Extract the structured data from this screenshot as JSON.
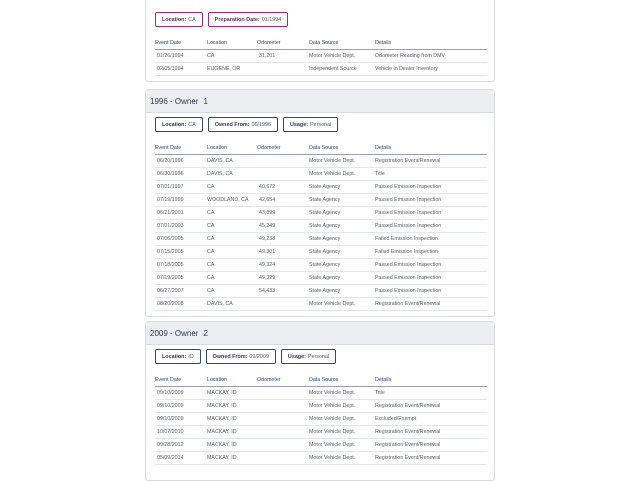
{
  "columns": [
    "Event Date",
    "Location",
    "Odometer",
    "Data Source",
    "Details"
  ],
  "sections": [
    {
      "header": null,
      "badges": [
        {
          "label": "Location:",
          "value": "CA"
        },
        {
          "label": "Preparation Date:",
          "value": "01/1994"
        }
      ],
      "rows": [
        [
          "01/26/1994",
          "CA",
          "31,201",
          "Motor Vehicle Dept.",
          "Odometer Reading from DMV"
        ],
        [
          "02/05/1994",
          "EUGENE, OR",
          "",
          "Independent Source",
          "Vehicle in Dealer Inventory"
        ]
      ]
    },
    {
      "header": {
        "year": "1996 - Owner",
        "num": "1"
      },
      "badges": [
        {
          "label": "Location:",
          "value": "CA"
        },
        {
          "label": "Owned From:",
          "value": "06/1996"
        },
        {
          "label": "Usage:",
          "value": "Personal"
        }
      ],
      "rows": [
        [
          "06/20/1996",
          "DAVIS, CA",
          "",
          "Motor Vehicle Dept.",
          "Registration Event/Renewal"
        ],
        [
          "06/30/1996",
          "DAVIS, CA",
          "",
          "Motor Vehicle Dept.",
          "Title"
        ],
        [
          "07/01/1997",
          "CA",
          "40,672",
          "State Agency",
          "Passed Emission Inspection"
        ],
        [
          "07/19/1999",
          "WOODLAND, CA",
          "42,654",
          "State Agency",
          "Passed Emission Inspection"
        ],
        [
          "06/21/2001",
          "CA",
          "43,899",
          "State Agency",
          "Passed Emission Inspection"
        ],
        [
          "07/01/2003",
          "CA",
          "45,249",
          "State Agency",
          "Passed Emission Inspection"
        ],
        [
          "07/06/2005",
          "CA",
          "49,238",
          "State Agency",
          "Failed Emission Inspection"
        ],
        [
          "07/15/2005",
          "CA",
          "49,301",
          "State Agency",
          "Failed Emission Inspection"
        ],
        [
          "07/18/2005",
          "CA",
          "49,324",
          "State Agency",
          "Passed Emission Inspection"
        ],
        [
          "07/19/2005",
          "CA",
          "49,329",
          "State Agency",
          "Passed Emission Inspection"
        ],
        [
          "06/27/2007",
          "CA",
          "54,433",
          "State Agency",
          "Passed Emission Inspection"
        ],
        [
          "08/20/2008",
          "DAVIS, CA",
          "",
          "Motor Vehicle Dept.",
          "Registration Event/Renewal"
        ]
      ]
    },
    {
      "header": {
        "year": "2009 - Owner",
        "num": "2"
      },
      "badges": [
        {
          "label": "Location:",
          "value": "ID"
        },
        {
          "label": "Owned From:",
          "value": "09/2009"
        },
        {
          "label": "Usage:",
          "value": "Personal"
        }
      ],
      "rows": [
        [
          "09/10/2009",
          "MACKAY, ID",
          "",
          "Motor Vehicle Dept.",
          "Title"
        ],
        [
          "09/10/2009",
          "MACKAY, ID",
          "",
          "Motor Vehicle Dept.",
          "Registration Event/Renewal"
        ],
        [
          "09/10/2009",
          "MACKAY, ID",
          "",
          "Motor Vehicle Dept.",
          "Excluded/Exempt"
        ],
        [
          "10/07/2010",
          "MACKAY, ID",
          "",
          "Motor Vehicle Dept.",
          "Registration Event/Renewal"
        ],
        [
          "09/28/2012",
          "MACKAY, ID",
          "",
          "Motor Vehicle Dept.",
          "Registration Event/Renewal"
        ],
        [
          "05/09/2014",
          "MACKAY, ID",
          "",
          "Motor Vehicle Dept.",
          "Registration Event/Renewal"
        ]
      ]
    }
  ]
}
